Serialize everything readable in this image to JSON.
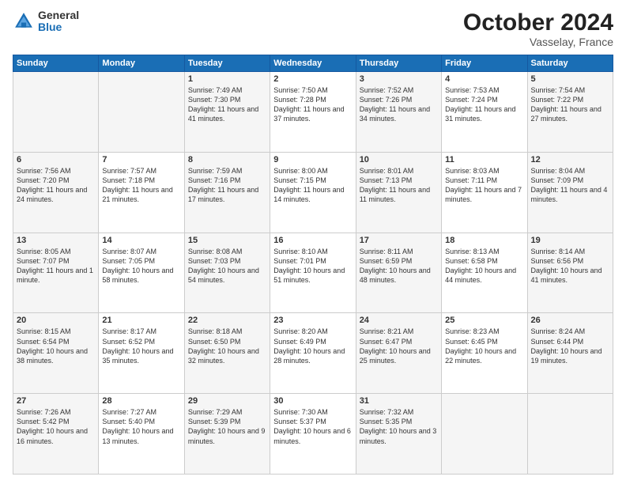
{
  "header": {
    "logo_general": "General",
    "logo_blue": "Blue",
    "month_title": "October 2024",
    "location": "Vasselay, France"
  },
  "days_of_week": [
    "Sunday",
    "Monday",
    "Tuesday",
    "Wednesday",
    "Thursday",
    "Friday",
    "Saturday"
  ],
  "weeks": [
    [
      {
        "day": "",
        "info": ""
      },
      {
        "day": "",
        "info": ""
      },
      {
        "day": "1",
        "info": "Sunrise: 7:49 AM\nSunset: 7:30 PM\nDaylight: 11 hours and 41 minutes."
      },
      {
        "day": "2",
        "info": "Sunrise: 7:50 AM\nSunset: 7:28 PM\nDaylight: 11 hours and 37 minutes."
      },
      {
        "day": "3",
        "info": "Sunrise: 7:52 AM\nSunset: 7:26 PM\nDaylight: 11 hours and 34 minutes."
      },
      {
        "day": "4",
        "info": "Sunrise: 7:53 AM\nSunset: 7:24 PM\nDaylight: 11 hours and 31 minutes."
      },
      {
        "day": "5",
        "info": "Sunrise: 7:54 AM\nSunset: 7:22 PM\nDaylight: 11 hours and 27 minutes."
      }
    ],
    [
      {
        "day": "6",
        "info": "Sunrise: 7:56 AM\nSunset: 7:20 PM\nDaylight: 11 hours and 24 minutes."
      },
      {
        "day": "7",
        "info": "Sunrise: 7:57 AM\nSunset: 7:18 PM\nDaylight: 11 hours and 21 minutes."
      },
      {
        "day": "8",
        "info": "Sunrise: 7:59 AM\nSunset: 7:16 PM\nDaylight: 11 hours and 17 minutes."
      },
      {
        "day": "9",
        "info": "Sunrise: 8:00 AM\nSunset: 7:15 PM\nDaylight: 11 hours and 14 minutes."
      },
      {
        "day": "10",
        "info": "Sunrise: 8:01 AM\nSunset: 7:13 PM\nDaylight: 11 hours and 11 minutes."
      },
      {
        "day": "11",
        "info": "Sunrise: 8:03 AM\nSunset: 7:11 PM\nDaylight: 11 hours and 7 minutes."
      },
      {
        "day": "12",
        "info": "Sunrise: 8:04 AM\nSunset: 7:09 PM\nDaylight: 11 hours and 4 minutes."
      }
    ],
    [
      {
        "day": "13",
        "info": "Sunrise: 8:05 AM\nSunset: 7:07 PM\nDaylight: 11 hours and 1 minute."
      },
      {
        "day": "14",
        "info": "Sunrise: 8:07 AM\nSunset: 7:05 PM\nDaylight: 10 hours and 58 minutes."
      },
      {
        "day": "15",
        "info": "Sunrise: 8:08 AM\nSunset: 7:03 PM\nDaylight: 10 hours and 54 minutes."
      },
      {
        "day": "16",
        "info": "Sunrise: 8:10 AM\nSunset: 7:01 PM\nDaylight: 10 hours and 51 minutes."
      },
      {
        "day": "17",
        "info": "Sunrise: 8:11 AM\nSunset: 6:59 PM\nDaylight: 10 hours and 48 minutes."
      },
      {
        "day": "18",
        "info": "Sunrise: 8:13 AM\nSunset: 6:58 PM\nDaylight: 10 hours and 44 minutes."
      },
      {
        "day": "19",
        "info": "Sunrise: 8:14 AM\nSunset: 6:56 PM\nDaylight: 10 hours and 41 minutes."
      }
    ],
    [
      {
        "day": "20",
        "info": "Sunrise: 8:15 AM\nSunset: 6:54 PM\nDaylight: 10 hours and 38 minutes."
      },
      {
        "day": "21",
        "info": "Sunrise: 8:17 AM\nSunset: 6:52 PM\nDaylight: 10 hours and 35 minutes."
      },
      {
        "day": "22",
        "info": "Sunrise: 8:18 AM\nSunset: 6:50 PM\nDaylight: 10 hours and 32 minutes."
      },
      {
        "day": "23",
        "info": "Sunrise: 8:20 AM\nSunset: 6:49 PM\nDaylight: 10 hours and 28 minutes."
      },
      {
        "day": "24",
        "info": "Sunrise: 8:21 AM\nSunset: 6:47 PM\nDaylight: 10 hours and 25 minutes."
      },
      {
        "day": "25",
        "info": "Sunrise: 8:23 AM\nSunset: 6:45 PM\nDaylight: 10 hours and 22 minutes."
      },
      {
        "day": "26",
        "info": "Sunrise: 8:24 AM\nSunset: 6:44 PM\nDaylight: 10 hours and 19 minutes."
      }
    ],
    [
      {
        "day": "27",
        "info": "Sunrise: 7:26 AM\nSunset: 5:42 PM\nDaylight: 10 hours and 16 minutes."
      },
      {
        "day": "28",
        "info": "Sunrise: 7:27 AM\nSunset: 5:40 PM\nDaylight: 10 hours and 13 minutes."
      },
      {
        "day": "29",
        "info": "Sunrise: 7:29 AM\nSunset: 5:39 PM\nDaylight: 10 hours and 9 minutes."
      },
      {
        "day": "30",
        "info": "Sunrise: 7:30 AM\nSunset: 5:37 PM\nDaylight: 10 hours and 6 minutes."
      },
      {
        "day": "31",
        "info": "Sunrise: 7:32 AM\nSunset: 5:35 PM\nDaylight: 10 hours and 3 minutes."
      },
      {
        "day": "",
        "info": ""
      },
      {
        "day": "",
        "info": ""
      }
    ]
  ]
}
